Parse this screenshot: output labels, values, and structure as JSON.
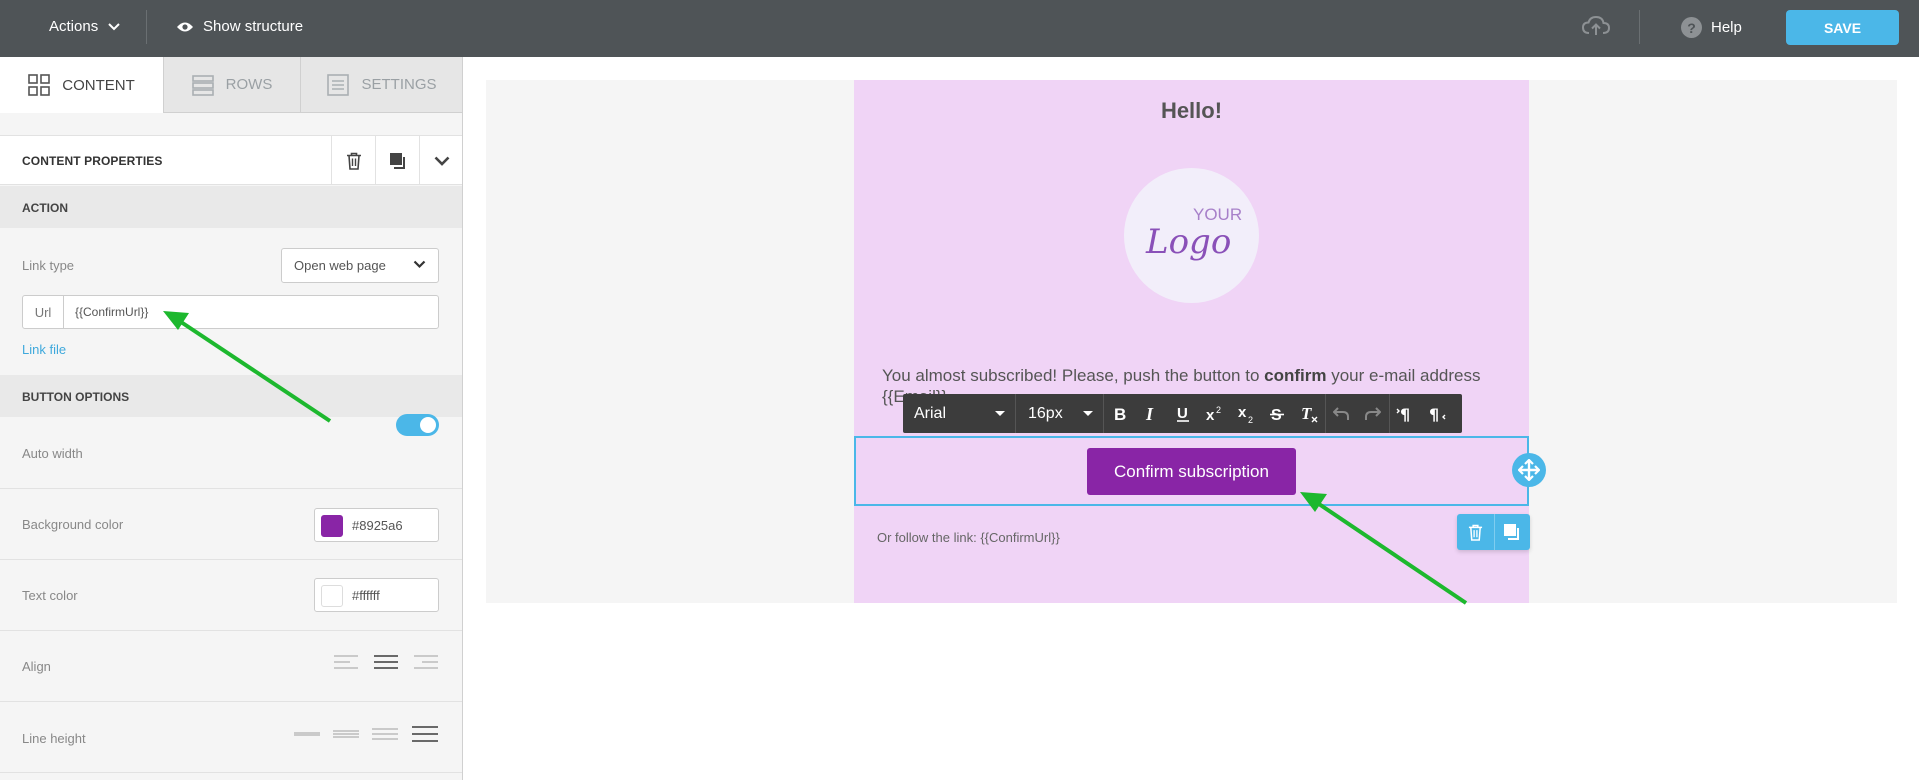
{
  "topbar": {
    "actions_label": "Actions",
    "structure_label": "Show structure",
    "help_label": "Help",
    "save_label": "SAVE"
  },
  "sidebar": {
    "tabs": [
      {
        "label": "CONTENT",
        "icon": "grid-icon",
        "active": true
      },
      {
        "label": "ROWS",
        "icon": "rows-icon",
        "active": false
      },
      {
        "label": "SETTINGS",
        "icon": "settings-icon",
        "active": false
      }
    ],
    "content_properties_title": "CONTENT PROPERTIES",
    "action_section": "ACTION",
    "link_type_label": "Link type",
    "link_type_value": "Open web page",
    "url_prefix": "Url",
    "url_value": "{{ConfirmUrl}}",
    "link_file_label": "Link file",
    "button_options_section": "BUTTON OPTIONS",
    "auto_width_label": "Auto width",
    "auto_width_on": true,
    "background_color_label": "Background color",
    "background_color_value": "#8925a6",
    "text_color_label": "Text color",
    "text_color_value": "#ffffff",
    "align_label": "Align",
    "line_height_label": "Line height"
  },
  "email": {
    "heading": "Hello!",
    "logo_top": "YOUR",
    "logo_bottom": "Logo",
    "paragraph_pre": "You almost subscribed! Please, push the button to ",
    "paragraph_bold": "confirm",
    "paragraph_post": " your e-mail address {{Email}}",
    "button_label": "Confirm subscription",
    "button_color": "#8925a6",
    "follow_text": "Or follow the link: {{ConfirmUrl}}",
    "background_color": "#f0d4f6"
  },
  "rte": {
    "font": "Arial",
    "size": "16px"
  },
  "colors": {
    "accent": "#4bb7e8",
    "topbar": "#4f5457",
    "annotation_arrow": "#1db82e"
  }
}
